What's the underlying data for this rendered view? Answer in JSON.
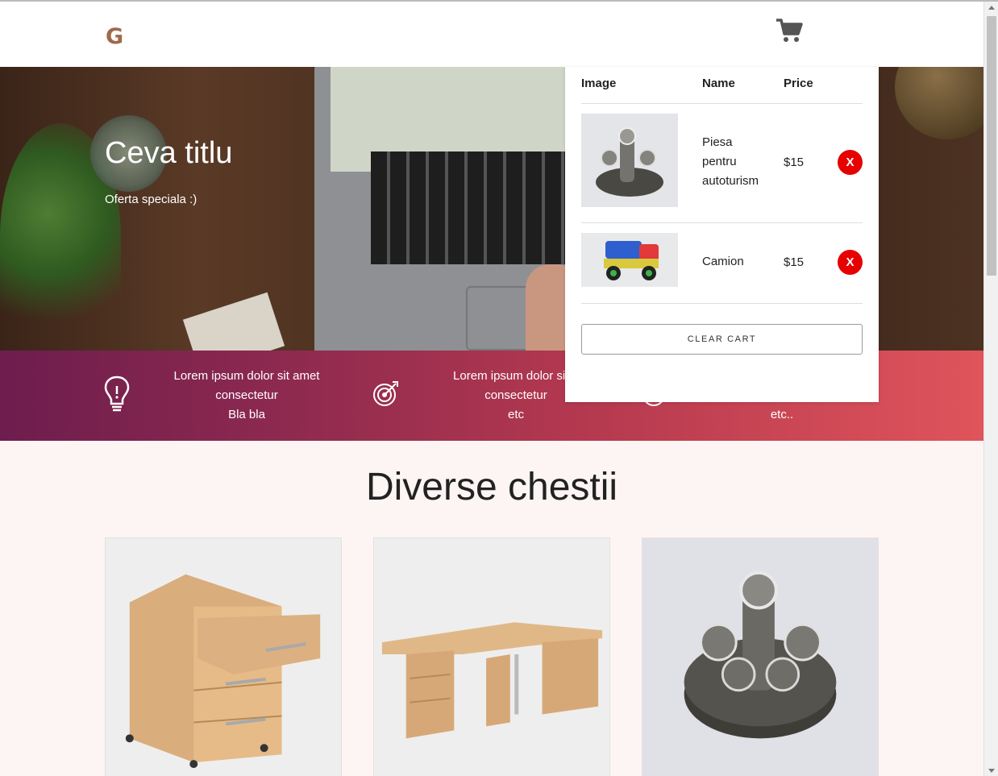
{
  "header": {
    "logo": "G",
    "cart_icon": "shopping-cart-icon"
  },
  "hero": {
    "title": "Ceva titlu",
    "subtitle": "Oferta speciala :)"
  },
  "features": [
    {
      "icon": "lightbulb-icon",
      "lines": [
        "Lorem ipsum dolor sit amet",
        "consectetur",
        "Bla bla"
      ]
    },
    {
      "icon": "target-icon",
      "lines": [
        "Lorem ipsum dolor sit a",
        "consectetur",
        "etc"
      ]
    },
    {
      "icon": "target-icon",
      "lines": [
        "",
        "",
        "etc.."
      ]
    }
  ],
  "cart": {
    "headers": {
      "image": "Image",
      "name": "Name",
      "price": "Price"
    },
    "items": [
      {
        "name": "Piesa pentru autoturism",
        "price": "$15",
        "remove_label": "X",
        "image": "car-part-image"
      },
      {
        "name": "Camion",
        "price": "$15",
        "remove_label": "X",
        "image": "toy-truck-image"
      }
    ],
    "clear_label": "CLEAR CART"
  },
  "products": {
    "title": "Diverse chestii",
    "items": [
      {
        "image": "drawer-cabinet-image"
      },
      {
        "image": "corner-desk-image"
      },
      {
        "image": "car-part-image"
      }
    ]
  },
  "colors": {
    "logo": "#a0684a",
    "band_start": "#6d1d4e",
    "band_end": "#e0545b",
    "remove": "#e60000",
    "page_bg": "#fdf5f4"
  }
}
